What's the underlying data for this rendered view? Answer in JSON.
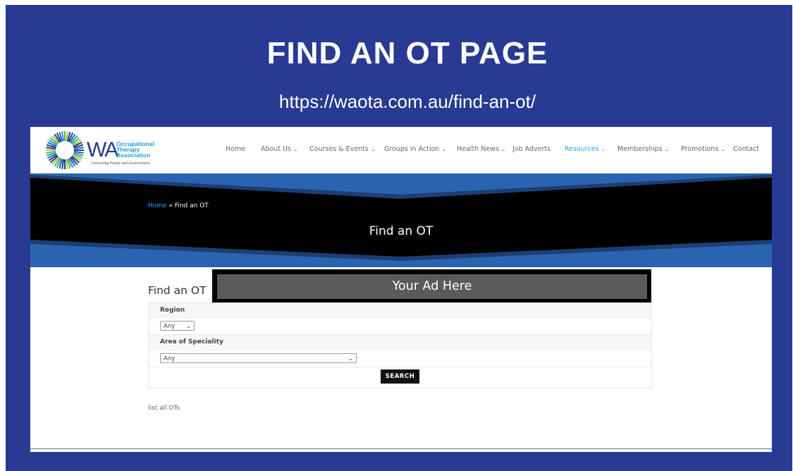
{
  "slide": {
    "title": "FIND AN OT PAGE",
    "url": "https://waota.com.au/find-an-ot/"
  },
  "logo": {
    "wa": "WA",
    "line1": "Occupational",
    "line2": "Therapy",
    "line3": "Association",
    "tagline": "Connecting People and Environments"
  },
  "nav": {
    "items": [
      {
        "label": "Home",
        "chevron": ""
      },
      {
        "label": "About Us",
        "chevron": "⌄"
      },
      {
        "label": "Courses & Events",
        "chevron": "⌄"
      },
      {
        "label": "Groups in Action",
        "chevron": "⌄"
      },
      {
        "label": "Health News",
        "chevron": "⌄"
      },
      {
        "label": "Job Adverts",
        "chevron": ""
      },
      {
        "label": "Resources",
        "chevron": "⌄"
      },
      {
        "label": "Memberships",
        "chevron": "⌄"
      },
      {
        "label": "Promotions",
        "chevron": "⌄"
      },
      {
        "label": "Contact",
        "chevron": ""
      }
    ],
    "active": "Resources"
  },
  "hero": {
    "breadcrumb_home": "Home",
    "breadcrumb_sep": " » ",
    "breadcrumb_current": "Find an OT",
    "title": "Find an OT"
  },
  "content": {
    "title": "Find an OT",
    "ad_text": "Your Ad Here",
    "region_label": "Region",
    "region_value": "Any",
    "speciality_label": "Area of Speciality",
    "speciality_value": "Any",
    "search_label": "SEARCH",
    "list_link": "list all OTs"
  },
  "colors": {
    "slide_bg": "#283a92",
    "accent": "#2ea3f2",
    "hero_bg": "#000000",
    "hero_band": "#2a64b0"
  },
  "icons": {
    "logo": "sunburst-logo-icon",
    "dropdown": "chevron-down-icon"
  }
}
